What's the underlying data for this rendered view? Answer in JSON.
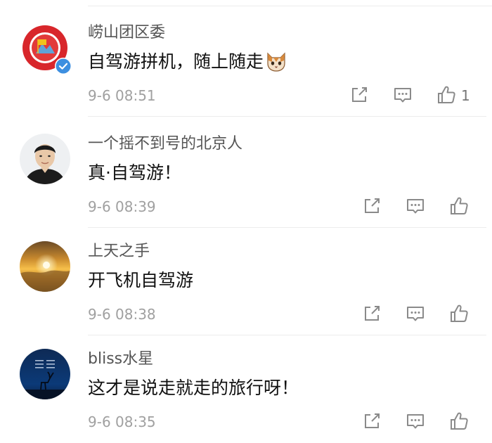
{
  "comments": [
    {
      "username": "崂山团区委",
      "text": "自驾游拼机，随上随走",
      "emoji": "cat-face-emoji",
      "timestamp": "9-6 08:51",
      "likes": "1",
      "verified": true,
      "avatar": "red-flag-emblem"
    },
    {
      "username": "一个摇不到号的北京人",
      "text": "真·自驾游！",
      "timestamp": "9-6 08:39",
      "likes": "",
      "avatar": "portrait-photo"
    },
    {
      "username": "上天之手",
      "text": "开飞机自驾游",
      "timestamp": "9-6 08:38",
      "likes": "",
      "avatar": "sunset-clouds"
    },
    {
      "username": "bliss水星",
      "text": "这才是说走就走的旅行呀！",
      "timestamp": "9-6 08:35",
      "likes": "",
      "avatar": "night-sky-deer"
    }
  ],
  "icons": {
    "share": "share-icon",
    "reply": "comment-icon",
    "like": "thumbs-up-icon",
    "verified": "verified-badge-icon"
  },
  "colors": {
    "verified_badge": "#3d8fe0",
    "icon_gray": "#8a8a8a",
    "timestamp": "#a0a0a0"
  }
}
